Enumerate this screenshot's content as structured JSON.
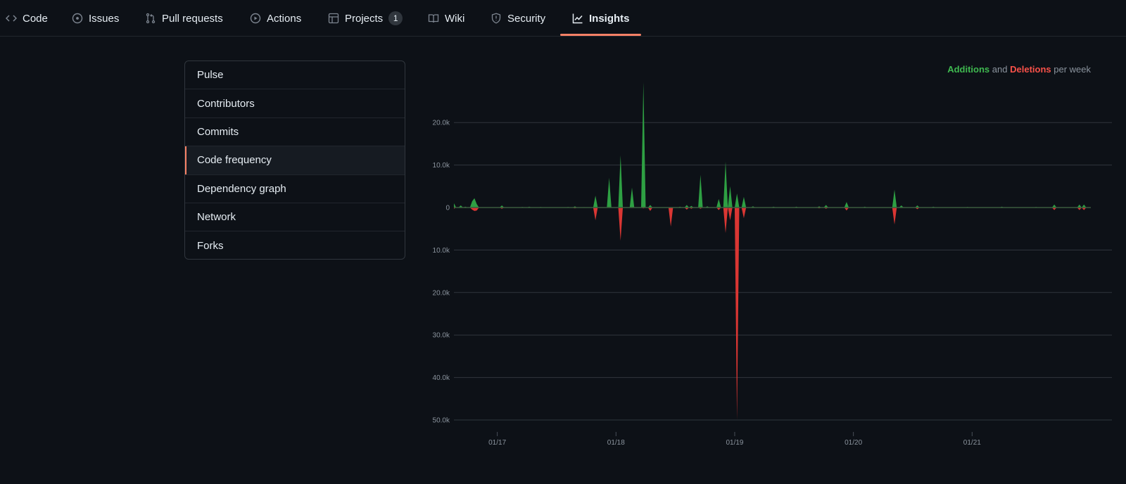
{
  "nav": {
    "items": [
      {
        "label": "Code",
        "icon": "code-icon"
      },
      {
        "label": "Issues",
        "icon": "issue-opened-icon"
      },
      {
        "label": "Pull requests",
        "icon": "git-pull-request-icon"
      },
      {
        "label": "Actions",
        "icon": "play-icon"
      },
      {
        "label": "Projects",
        "icon": "table-icon",
        "counter": "1"
      },
      {
        "label": "Wiki",
        "icon": "book-icon"
      },
      {
        "label": "Security",
        "icon": "shield-icon"
      },
      {
        "label": "Insights",
        "icon": "graph-icon",
        "active": true
      }
    ]
  },
  "sidebar": {
    "items": [
      {
        "label": "Pulse"
      },
      {
        "label": "Contributors"
      },
      {
        "label": "Commits"
      },
      {
        "label": "Code frequency",
        "selected": true
      },
      {
        "label": "Dependency graph"
      },
      {
        "label": "Network"
      },
      {
        "label": "Forks"
      }
    ]
  },
  "legend": {
    "additions": "Additions",
    "and": "and",
    "deletions": "Deletions",
    "suffix": "per week"
  },
  "colors": {
    "additions": "#2ea043",
    "deletions": "#da3633",
    "accent": "#f78166"
  },
  "chart_data": {
    "type": "area",
    "title": "Additions and Deletions per week",
    "xlabel": "",
    "ylabel": "",
    "x_unit": "week index",
    "num_weeks": 280,
    "x_ticks": [
      {
        "week": 19,
        "label": "01/17"
      },
      {
        "week": 71,
        "label": "01/18"
      },
      {
        "week": 123,
        "label": "01/19"
      },
      {
        "week": 175,
        "label": "01/20"
      },
      {
        "week": 227,
        "label": "01/21"
      }
    ],
    "y_ticks": [
      {
        "value": 20000,
        "label": "20.0k"
      },
      {
        "value": 10000,
        "label": "10.0k"
      },
      {
        "value": 0,
        "label": "0"
      },
      {
        "value": -10000,
        "label": "10.0k"
      },
      {
        "value": -20000,
        "label": "20.0k"
      },
      {
        "value": -30000,
        "label": "30.0k"
      },
      {
        "value": -40000,
        "label": "40.0k"
      },
      {
        "value": -50000,
        "label": "50.0k"
      }
    ],
    "ylim": [
      -50000,
      29500
    ],
    "grid": true,
    "legend_position": "top-right",
    "series": [
      {
        "name": "Additions",
        "color": "#2ea043"
      },
      {
        "name": "Deletions",
        "color": "#da3633"
      }
    ],
    "points_note": "sparse [week, additions, deletions]; unlisted weeks are small (~0)",
    "points": [
      [
        0,
        1000,
        -300
      ],
      [
        3,
        500,
        0
      ],
      [
        5,
        200,
        -100
      ],
      [
        8,
        1500,
        -500
      ],
      [
        9,
        2200,
        -800
      ],
      [
        10,
        800,
        -700
      ],
      [
        21,
        500,
        -300
      ],
      [
        30,
        150,
        0
      ],
      [
        33,
        200,
        -50
      ],
      [
        38,
        150,
        0
      ],
      [
        42,
        100,
        -50
      ],
      [
        50,
        150,
        0
      ],
      [
        53,
        300,
        -200
      ],
      [
        57,
        100,
        0
      ],
      [
        62,
        2800,
        -3000
      ],
      [
        68,
        7000,
        -100
      ],
      [
        73,
        12300,
        -7800
      ],
      [
        78,
        4700,
        -100
      ],
      [
        83,
        29500,
        -200
      ],
      [
        86,
        600,
        -800
      ],
      [
        95,
        100,
        -4500
      ],
      [
        99,
        200,
        0
      ],
      [
        102,
        600,
        -500
      ],
      [
        104,
        400,
        -300
      ],
      [
        108,
        7700,
        -300
      ],
      [
        111,
        300,
        -100
      ],
      [
        116,
        2000,
        -600
      ],
      [
        119,
        10800,
        -6000
      ],
      [
        121,
        5000,
        -3000
      ],
      [
        124,
        3300,
        -50000
      ],
      [
        127,
        2500,
        -2500
      ],
      [
        131,
        300,
        -100
      ],
      [
        140,
        200,
        -100
      ],
      [
        150,
        200,
        -100
      ],
      [
        160,
        300,
        -200
      ],
      [
        163,
        600,
        -300
      ],
      [
        172,
        1300,
        -700
      ],
      [
        180,
        200,
        -100
      ],
      [
        193,
        4200,
        -4000
      ],
      [
        196,
        500,
        -100
      ],
      [
        203,
        500,
        -400
      ],
      [
        210,
        200,
        0
      ],
      [
        225,
        150,
        -50
      ],
      [
        240,
        200,
        -100
      ],
      [
        255,
        150,
        -50
      ],
      [
        263,
        700,
        -600
      ],
      [
        274,
        700,
        -600
      ],
      [
        276,
        700,
        -600
      ]
    ]
  }
}
